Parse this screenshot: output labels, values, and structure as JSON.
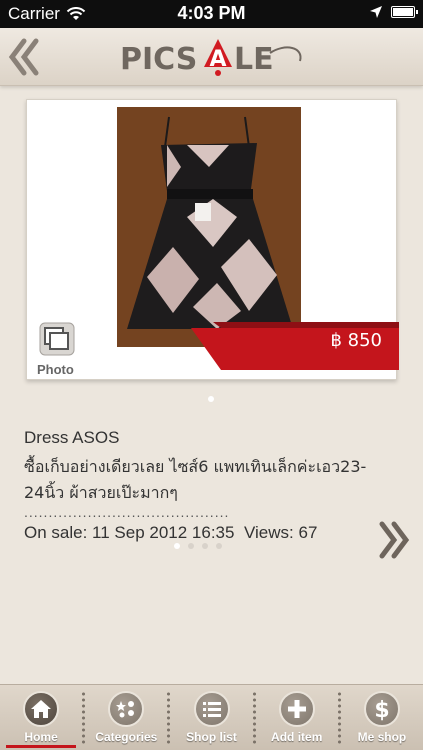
{
  "status_bar": {
    "carrier": "Carrier",
    "time": "4:03 PM"
  },
  "header": {
    "logo_text": "PICSALE",
    "back_icon": "double-chevron-left-icon"
  },
  "product": {
    "photo_label": "Photo",
    "price": "฿ 850",
    "title": "Dress ASOS",
    "description": "ซื้อเก็บอย่างเดียวเลย ไซส์6 แพทเทินเล็กค่ะเอว23-24นิ้ว ผ้าสวยเป๊ะมากๆ",
    "dotted_line": "..........................................",
    "on_sale": "On sale: 11 Sep 2012 16:35",
    "views": "Views: 67"
  },
  "colors": {
    "accent_red": "#c4151c",
    "background": "#ece6dd"
  },
  "tabs": [
    {
      "label": "Home",
      "icon": "home-icon"
    },
    {
      "label": "Categories",
      "icon": "categories-icon"
    },
    {
      "label": "Shop list",
      "icon": "list-icon"
    },
    {
      "label": "Add item",
      "icon": "plus-icon"
    },
    {
      "label": "Me shop",
      "icon": "dollar-icon"
    }
  ]
}
